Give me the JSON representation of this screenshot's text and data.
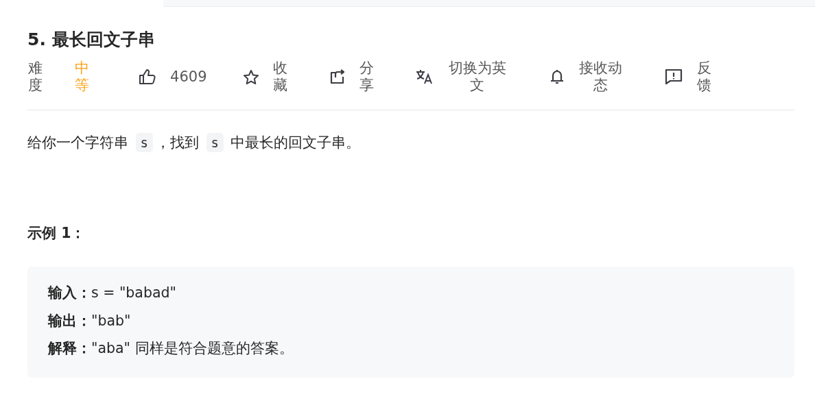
{
  "problem": {
    "title": "5. 最长回文子串"
  },
  "toolbar": [
    {
      "kind": "difficulty",
      "label": "难度",
      "value": "中等",
      "color": "#ffa116"
    },
    {
      "kind": "like",
      "label": "4609"
    },
    {
      "kind": "favorite",
      "label": "收藏"
    },
    {
      "kind": "share",
      "label": "分享"
    },
    {
      "kind": "translate",
      "label": "切换为英文"
    },
    {
      "kind": "subscribe",
      "label": "接收动态"
    },
    {
      "kind": "feedback",
      "label": "反馈"
    }
  ],
  "description": [
    {
      "kind": "text",
      "text": "给你一个字符串 "
    },
    {
      "kind": "code",
      "text": "s"
    },
    {
      "kind": "text",
      "text": "，找到 "
    },
    {
      "kind": "code",
      "text": "s"
    },
    {
      "kind": "text",
      "text": " 中最长的回文子串。"
    }
  ],
  "example": {
    "heading": "示例 1：",
    "lines": [
      "**输入：**s = \"babad\"",
      "**输出：**\"bab\"",
      "**解释：**\"aba\" 同样是符合题意的答案。"
    ]
  }
}
